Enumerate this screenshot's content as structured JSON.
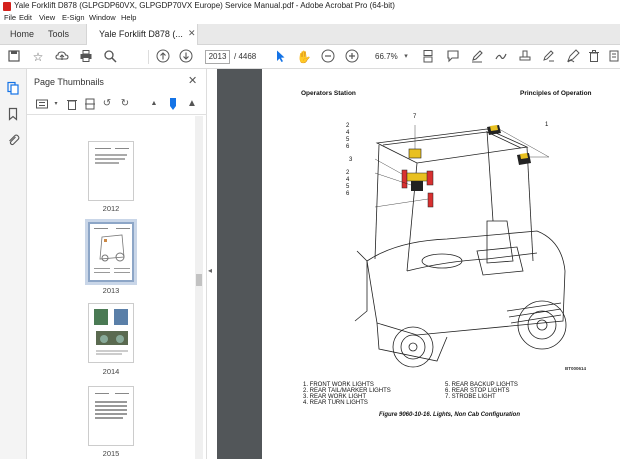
{
  "window": {
    "title": "Yale Forklift D878 (GLPGDP60VX, GLPGDP70VX Europe) Service Manual.pdf - Adobe Acrobat Pro (64-bit)"
  },
  "menu": [
    "File",
    "Edit",
    "View",
    "E-Sign",
    "Window",
    "Help"
  ],
  "tabs": {
    "home": "Home",
    "tools": "Tools",
    "document": "Yale Forklift D878 (..."
  },
  "toolbar": {
    "current_page": "2013",
    "total_pages": "/ 4468",
    "zoom": "66.7%"
  },
  "panel": {
    "title": "Page Thumbnails",
    "thumbnails": [
      {
        "label": "2012",
        "selected": false
      },
      {
        "label": "2013",
        "selected": true
      },
      {
        "label": "2014",
        "selected": false
      },
      {
        "label": "2015",
        "selected": false
      }
    ]
  },
  "document": {
    "header_left": "Operators Station",
    "header_right": "Principles of Operation",
    "figure_code": "BT000614",
    "legend": [
      "1.  FRONT WORK LIGHTS",
      "2.  REAR TAIL/MARKER LIGHTS",
      "3.  REAR WORK LIGHT",
      "4.  REAR TURN LIGHTS",
      "5.  REAR BACKUP LIGHTS",
      "6.  REAR STOP LIGHTS",
      "7.  STROBE LIGHT"
    ],
    "caption": "Figure 9060-10-16. Lights, Non Cab Configuration",
    "callouts": [
      "7",
      "2",
      "4",
      "5",
      "6",
      "3",
      "2",
      "4",
      "5",
      "6",
      "1"
    ]
  },
  "colors": {
    "accent": "#1473e6",
    "acrobat_red": "#d4211c",
    "doc_background": "#525659",
    "light_yellow": "#e8c020",
    "light_red": "#d83030"
  }
}
